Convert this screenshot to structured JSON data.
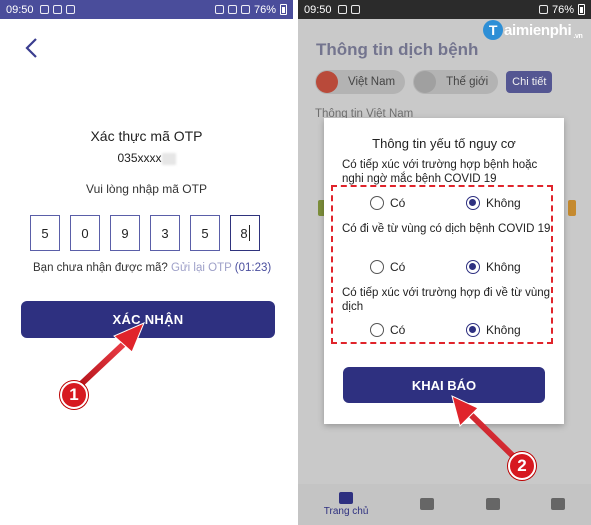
{
  "left_screen": {
    "status_time": "09:50",
    "status_battery": "76%",
    "otp_title": "Xác thực mã OTP",
    "phone_masked": "035xxxx",
    "prompt": "Vui lòng nhập mã OTP",
    "otp_digits": [
      "5",
      "0",
      "9",
      "3",
      "5",
      "8"
    ],
    "resend_question": "Bạn chưa nhận được mã?",
    "resend_link": "Gửi lại OTP",
    "resend_timer": "(01:23)",
    "confirm_button": "XÁC NHẬN",
    "step_badge": "1"
  },
  "right_screen": {
    "status_time": "09:50",
    "status_battery": "76%",
    "logo_letter": "T",
    "logo_text": "aimienphi",
    "logo_suffix": ".vn",
    "page_title": "Thông tin dịch bệnh",
    "tabs": [
      "Việt Nam",
      "Thế giới"
    ],
    "detail_button": "Chi tiết",
    "sub_heading": "Thông tin Việt Nam",
    "dialog": {
      "title": "Thông tin yếu tố nguy cơ",
      "questions": [
        {
          "text": "Có tiếp xúc với trường hợp bệnh hoặc nghi ngờ mắc bệnh COVID 19",
          "yes": "Có",
          "no": "Không",
          "selected": "no"
        },
        {
          "text": "Có đi về từ vùng có dịch bệnh COVID 19",
          "yes": "Có",
          "no": "Không",
          "selected": "no"
        },
        {
          "text": "Có tiếp xúc với trường hợp đi về từ vùng dịch",
          "yes": "Có",
          "no": "Không",
          "selected": "no"
        }
      ],
      "submit_button": "KHAI BÁO"
    },
    "bottom_nav": {
      "home_label": "Trang chủ"
    },
    "step_badge": "2"
  },
  "colors": {
    "primary": "#2e3080",
    "status_bar_left": "#4a4d9b",
    "annotation_red": "#e0242b"
  }
}
